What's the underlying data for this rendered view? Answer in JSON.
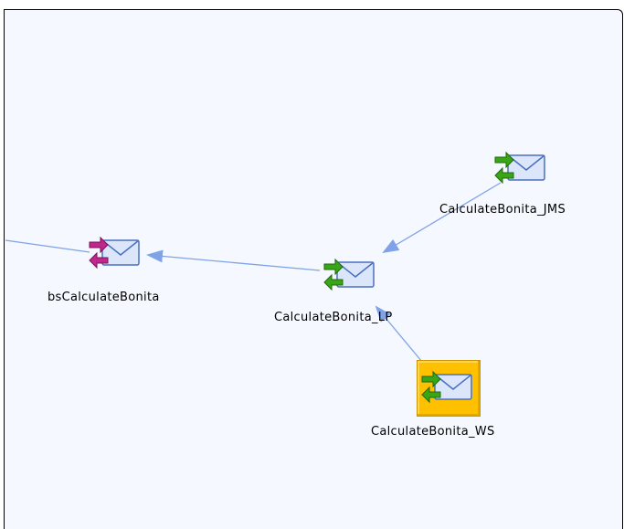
{
  "nodes": [
    {
      "id": "bs",
      "label": "bsCalculateBonita",
      "icon": "business-service-icon",
      "arrow_color": "#c0268c",
      "selected": false
    },
    {
      "id": "lp",
      "label": "CalculateBonita_LP",
      "icon": "proxy-service-icon",
      "arrow_color": "#3aa517",
      "selected": false
    },
    {
      "id": "jms",
      "label": "CalculateBonita_JMS",
      "icon": "proxy-service-icon",
      "arrow_color": "#3aa517",
      "selected": false
    },
    {
      "id": "ws",
      "label": "CalculateBonita_WS",
      "icon": "proxy-service-icon",
      "arrow_color": "#3aa517",
      "selected": true
    }
  ],
  "edges": [
    {
      "from": "lp",
      "to": "bs"
    },
    {
      "from": "jms",
      "to": "lp"
    },
    {
      "from": "ws",
      "to": "lp"
    },
    {
      "from": "bs",
      "to": "offscreen-left"
    }
  ],
  "colors": {
    "edge": "#7fa3e6",
    "canvas_bg": "#f5f8ff",
    "selection": "#ffc000"
  }
}
